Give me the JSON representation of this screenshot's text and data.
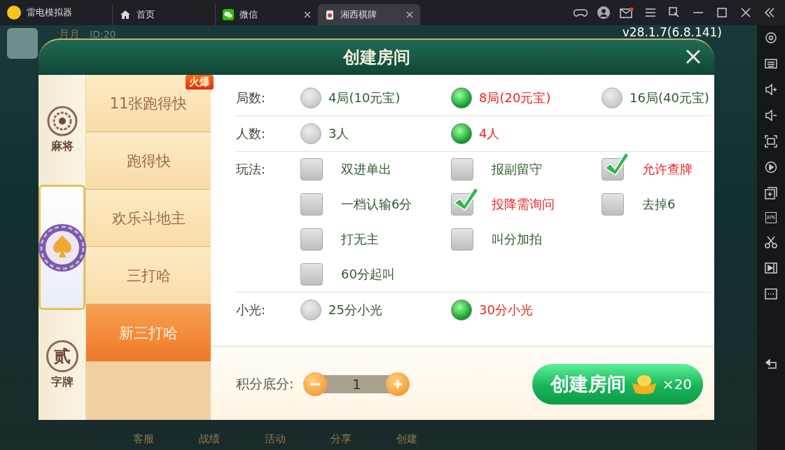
{
  "app": {
    "name": "雷电模拟器"
  },
  "tabs": [
    {
      "label": "首页",
      "kind": "home",
      "selected": false,
      "closable": false
    },
    {
      "label": "微信",
      "kind": "chat",
      "selected": false,
      "closable": true
    },
    {
      "label": "湘西棋牌",
      "kind": "game",
      "selected": true,
      "closable": true
    }
  ],
  "version": "v28.1.7(6.8.141)",
  "profile": {
    "name": "月月",
    "id": "ID:20"
  },
  "bottom_nav": [
    "客服",
    "战绩",
    "活动",
    "分享",
    "创建"
  ],
  "side_tools": [
    {
      "kind": "settings"
    },
    {
      "kind": "keyboard"
    },
    {
      "kind": "volume-up"
    },
    {
      "kind": "volume-down"
    },
    {
      "kind": "screen"
    },
    {
      "kind": "rotate"
    },
    {
      "kind": "add-window"
    },
    {
      "kind": "apk",
      "label": "APK"
    },
    {
      "kind": "scissors"
    },
    {
      "kind": "video"
    },
    {
      "kind": "more"
    }
  ],
  "dialog": {
    "title": "创建房间",
    "categories": [
      {
        "kind": "tile",
        "label": "麻将",
        "selected": false
      },
      {
        "kind": "spade",
        "selected": true
      },
      {
        "kind": "character",
        "emblem": "贰",
        "label": "字牌",
        "selected": false
      }
    ],
    "games": [
      {
        "label": "11张跑得快",
        "badge": "火爆",
        "selected": false
      },
      {
        "label": "跑得快",
        "selected": false
      },
      {
        "label": "欢乐斗地主",
        "selected": false
      },
      {
        "label": "三打哈",
        "selected": false
      },
      {
        "label": "新三打哈",
        "selected": true
      }
    ],
    "sections": [
      {
        "label": "局数:",
        "kind": "radio",
        "rows": [
          [
            {
              "label": "4局(10元宝)",
              "selected": false
            },
            {
              "label": "8局(20元宝)",
              "selected": true
            },
            {
              "label": "16局(40元宝)",
              "selected": false
            }
          ]
        ]
      },
      {
        "label": "人数:",
        "kind": "radio",
        "rows": [
          [
            {
              "label": "3人",
              "selected": false
            },
            {
              "label": "4人",
              "selected": true
            }
          ]
        ]
      },
      {
        "label": "玩法:",
        "kind": "checkbox",
        "rows": [
          [
            {
              "label": "双进单出",
              "checked": false
            },
            {
              "label": "报副留守",
              "checked": false
            },
            {
              "label": "允许查牌",
              "checked": true
            }
          ],
          [
            {
              "label": "一档认输6分",
              "checked": false
            },
            {
              "label": "投降需询问",
              "checked": true
            },
            {
              "label": "去掉6",
              "checked": false
            }
          ],
          [
            {
              "label": "打无主",
              "checked": false
            },
            {
              "label": "叫分加拍",
              "checked": false
            }
          ],
          [
            {
              "label": "60分起叫",
              "checked": false
            }
          ]
        ]
      },
      {
        "label": "小光:",
        "kind": "radio",
        "rows": [
          [
            {
              "label": "25分小光",
              "selected": false
            },
            {
              "label": "30分小光",
              "selected": true
            }
          ]
        ]
      }
    ],
    "score": {
      "label": "积分底分:",
      "value": "1"
    },
    "create_button": {
      "label": "创建房间",
      "cost": "×20"
    }
  }
}
